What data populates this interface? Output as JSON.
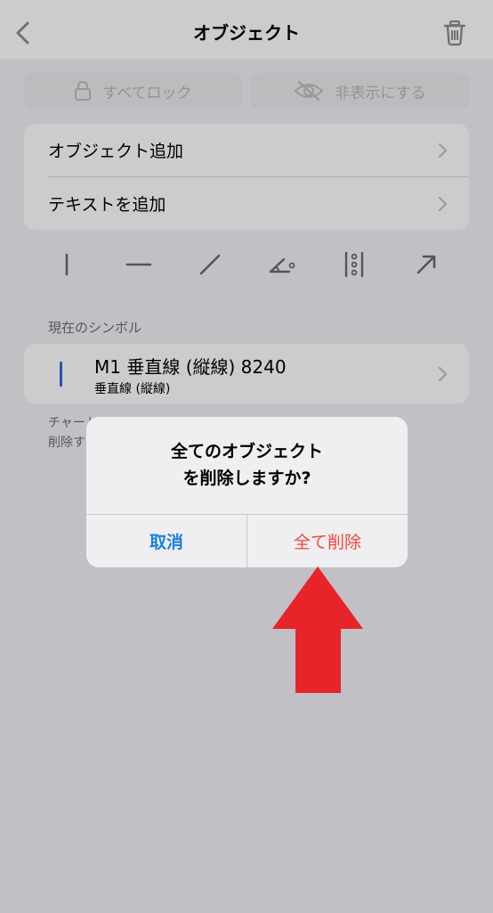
{
  "header": {
    "title": "オブジェクト"
  },
  "top_buttons": {
    "lock_all": "すべてロック",
    "hide": "非表示にする"
  },
  "menu": {
    "items": [
      {
        "label": "オブジェクト追加"
      },
      {
        "label": "テキストを追加"
      }
    ]
  },
  "tools": [
    "vertical-line-icon",
    "horizontal-line-icon",
    "trend-line-icon",
    "angle-icon",
    "fibonacci-icon",
    "arrow-icon"
  ],
  "current_symbol": {
    "section_label": "現在のシンボル",
    "title": "M1 垂直線 (縦線) 8240",
    "subtitle": "垂直線 (縦線)"
  },
  "footer_note": {
    "line1": "チャート",
    "line2": "削除す"
  },
  "alert": {
    "title_line1": "全てのオブジェクト",
    "title_line2": "を削除しますか?",
    "cancel_label": "取消",
    "delete_label": "全て削除"
  },
  "colors": {
    "accent_blue": "#1a7fe0",
    "destructive_red": "#f2443a",
    "annotation_arrow": "#e8232a",
    "symbol_bar": "#2a6fd6"
  }
}
